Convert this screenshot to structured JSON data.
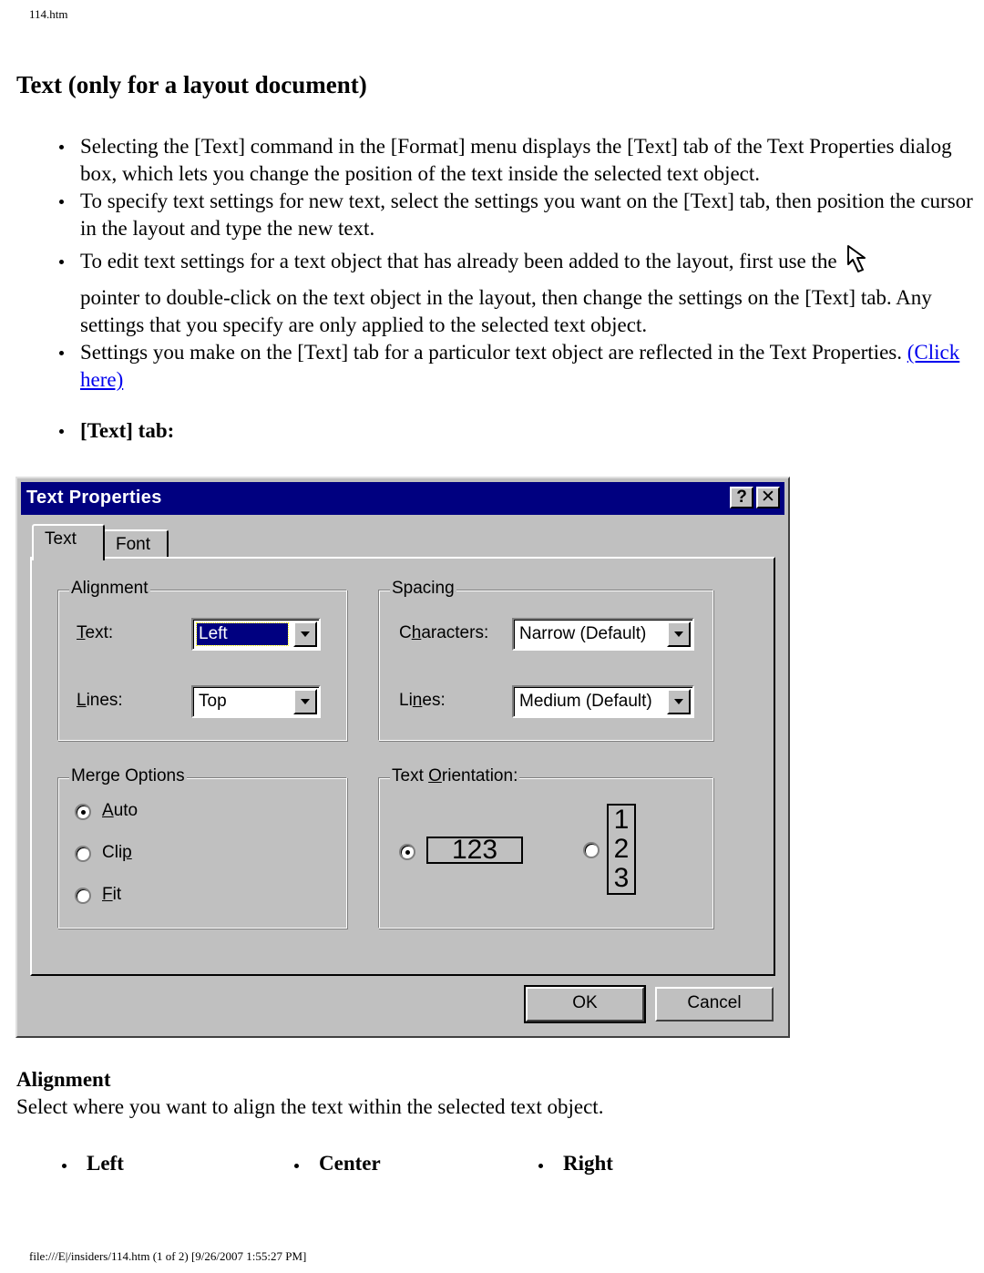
{
  "header": {
    "file_name": "114.htm"
  },
  "page_title": "Text (only for a layout document)",
  "intro_bullets": [
    {
      "text": "Selecting the [Text] command in the [Format] menu displays the [Text] tab of the Text Properties dialog box, which lets you change the position of the text inside the selected text object."
    },
    {
      "text": "To specify text settings for new text, select the settings you want on the [Text] tab, then position the cursor in the layout and type the new text."
    },
    {
      "text_before_icon": "To edit text settings for a text object that has already been added to the layout, first use the",
      "icon": "pointer-arrow-icon",
      "text_after_icon": "pointer to double-click on the text object in the layout, then change the settings on the [Text] tab. Any settings that you specify are only applied to the selected text object."
    },
    {
      "text": "Settings you make on the [Text] tab for a particulor text object are reflected in the Text Properties.",
      "link_label": "(Click here) "
    }
  ],
  "text_tab_bullet": "[Text] tab:",
  "dialog": {
    "title": "Text Properties",
    "help_button": "?",
    "close_button": "✕",
    "tabs": [
      {
        "label": "Text",
        "active": true
      },
      {
        "label": "Font",
        "active": false
      }
    ],
    "alignment": {
      "legend": "Alignment",
      "text_label": {
        "accel": "T",
        "rest": "ext:"
      },
      "text_value": "Left",
      "lines_label": {
        "accel": "L",
        "rest": "ines:"
      },
      "lines_value": "Top"
    },
    "spacing": {
      "legend": "Spacing",
      "characters_label": {
        "pre": "C",
        "accel": "h",
        "rest": "aracters:"
      },
      "characters_value": "Narrow (Default)",
      "lines_label": {
        "pre": "Li",
        "accel": "n",
        "rest": "es:"
      },
      "lines_value": "Medium (Default)"
    },
    "merge_options": {
      "legend": "Merge Options",
      "options": [
        {
          "pre": "",
          "accel": "A",
          "rest": "uto",
          "selected": true
        },
        {
          "pre": "Cli",
          "accel": "p",
          "rest": "",
          "selected": false
        },
        {
          "pre": "",
          "accel": "F",
          "rest": "it",
          "selected": false
        }
      ]
    },
    "text_orientation": {
      "legend": {
        "pre": "Text ",
        "accel": "O",
        "rest": "rientation:"
      },
      "horizontal_sample": "123",
      "vertical_sample": [
        "1",
        "2",
        "3"
      ],
      "selected": "horizontal"
    },
    "ok_label": "OK",
    "cancel_label": "Cancel"
  },
  "alignment_section": {
    "heading": "Alignment",
    "description": "Select where you want to align the text within the selected text object.",
    "options": [
      "Left",
      "Center",
      "Right"
    ]
  },
  "footer": {
    "text": "file:///E|/insiders/114.htm (1 of 2) [9/26/2007 1:55:27 PM]"
  }
}
